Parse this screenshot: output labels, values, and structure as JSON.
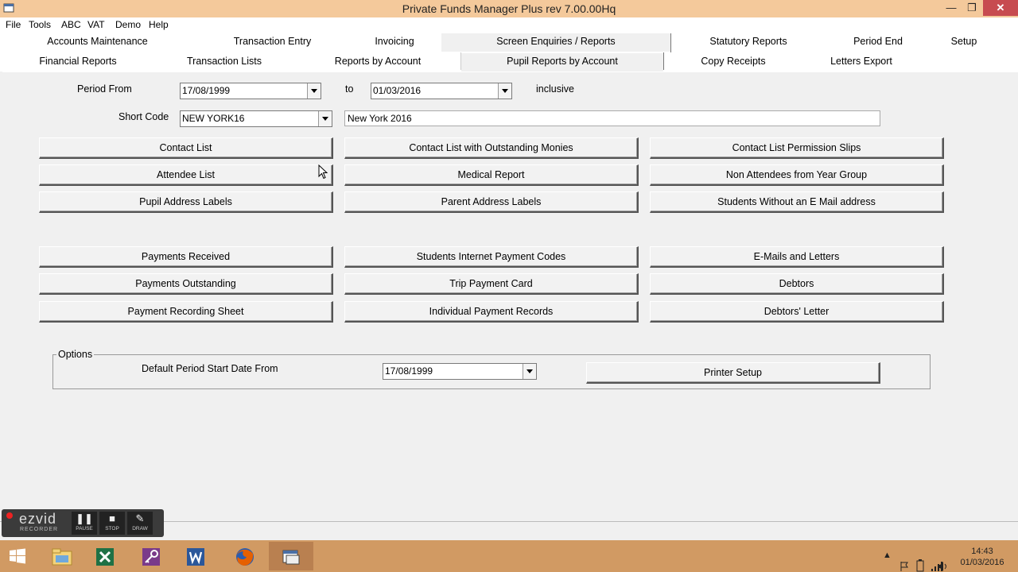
{
  "window": {
    "title": "Private Funds Manager Plus rev 7.00.00Hq",
    "minimize": "—",
    "maximize": "❐",
    "close": "✕"
  },
  "menu": [
    "File",
    "Tools",
    "ABC",
    "VAT",
    "Demo",
    "Help"
  ],
  "tabs": {
    "row1": [
      "Accounts Maintenance",
      "Transaction Entry",
      "Invoicing",
      "Screen Enquiries / Reports",
      "Statutory Reports",
      "Period End",
      "Setup"
    ],
    "row2": [
      "Financial Reports",
      "Transaction Lists",
      "Reports by Account",
      "Pupil Reports by Account",
      "Copy Receipts",
      "Letters Export"
    ],
    "active": "Pupil Reports by Account"
  },
  "filters": {
    "period_from_label": "Period From",
    "period_from_value": "17/08/1999",
    "to_label": "to",
    "period_to_value": "01/03/2016",
    "inclusive_label": "inclusive",
    "short_code_label": "Short Code",
    "short_code_value": "NEW YORK16",
    "short_code_description": "New York 2016"
  },
  "buttons": {
    "col1": [
      "Contact List",
      "Attendee List",
      "Pupil Address Labels",
      "Payments Received",
      "Payments Outstanding",
      "Payment Recording Sheet"
    ],
    "col2": [
      "Contact List with Outstanding Monies",
      "Medical Report",
      "Parent Address Labels",
      "Students Internet Payment Codes",
      "Trip Payment Card",
      "Individual Payment Records"
    ],
    "col3": [
      "Contact List Permission Slips",
      "Non Attendees from Year Group",
      "Students Without an E Mail address",
      "E-Mails and Letters",
      "Debtors",
      "Debtors' Letter"
    ]
  },
  "options": {
    "legend": "Options",
    "default_start_label": "Default Period Start Date From",
    "default_start_value": "17/08/1999",
    "printer_setup": "Printer Setup"
  },
  "recorder": {
    "logo": "ezvid",
    "subtitle": "RECORDER",
    "pause": "PAUSE",
    "stop": "STOP",
    "draw": "DRAW"
  },
  "taskbar": {
    "time": "14:43",
    "date": "01/03/2016"
  },
  "colors": {
    "titlebar": "#f4c99b",
    "taskbar": "#d19a63",
    "close": "#c74b50"
  }
}
